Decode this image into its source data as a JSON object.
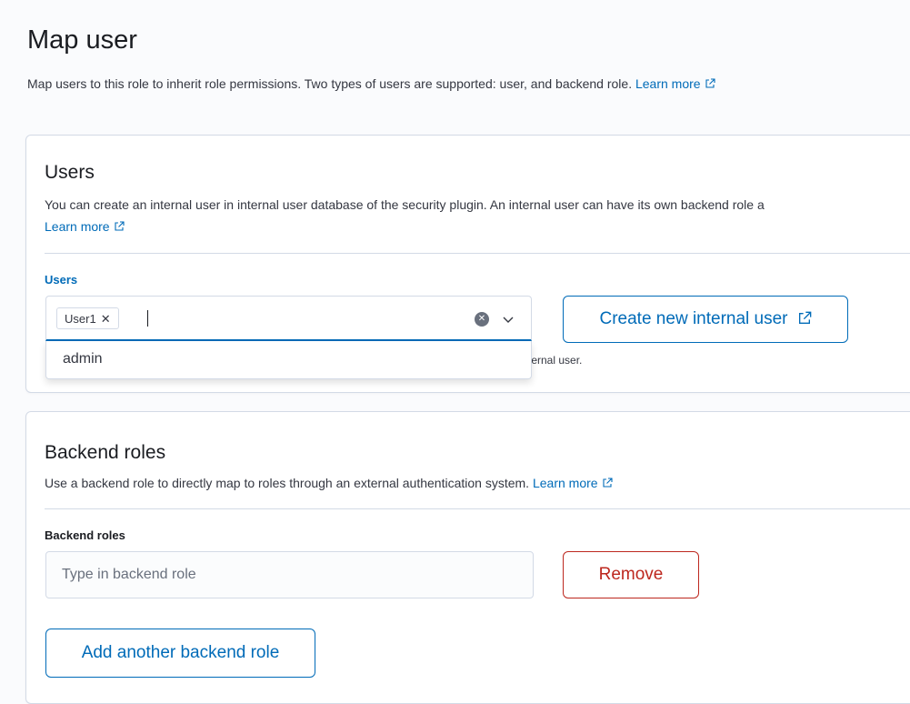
{
  "page": {
    "title": "Map user",
    "description": "Map users to this role to inherit role permissions. Two types of users are supported: user, and backend role.",
    "learn_more": "Learn more"
  },
  "users": {
    "heading": "Users",
    "description": "You can create an internal user in internal user database of the security plugin. An internal user can have its own backend role a",
    "learn_more": "Learn more",
    "field_label": "Users",
    "selected": [
      "User1"
    ],
    "options": [
      "admin"
    ],
    "help_text": "xternal user.",
    "create_button": "Create new internal user"
  },
  "backend_roles": {
    "heading": "Backend roles",
    "description": "Use a backend role to directly map to roles through an external authentication system.",
    "learn_more": "Learn more",
    "field_label": "Backend roles",
    "input_placeholder": "Type in backend role",
    "remove_button": "Remove",
    "add_button": "Add another backend role"
  },
  "icons": {
    "external": "external-link-icon",
    "clear": "clear-icon",
    "chevron": "chevron-down-icon",
    "remove_tag": "close-icon"
  },
  "colors": {
    "primary": "#006bb8",
    "danger": "#bd271e",
    "border": "#d3dae6"
  }
}
